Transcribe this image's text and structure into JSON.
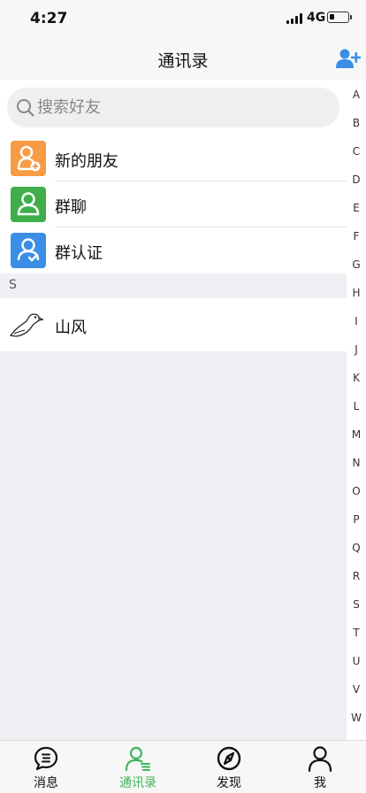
{
  "status_bar": {
    "time": "4:27",
    "network": "4G",
    "battery_percent": 20
  },
  "header": {
    "title": "通讯录",
    "add_icon": "add-friend-icon"
  },
  "search": {
    "placeholder": "搜索好友",
    "value": ""
  },
  "menu": [
    {
      "label": "新的朋友",
      "icon": "new-friend-icon",
      "color": "#f79b44"
    },
    {
      "label": "群聊",
      "icon": "group-chat-icon",
      "color": "#3fae4a"
    },
    {
      "label": "群认证",
      "icon": "group-verify-icon",
      "color": "#3a8ee6"
    }
  ],
  "sections": [
    {
      "letter": "S",
      "contacts": [
        {
          "name": "山风",
          "avatar": "goose-avatar"
        }
      ]
    }
  ],
  "index_letters": [
    "A",
    "B",
    "C",
    "D",
    "E",
    "F",
    "G",
    "H",
    "I",
    "J",
    "K",
    "L",
    "M",
    "N",
    "O",
    "P",
    "Q",
    "R",
    "S",
    "T",
    "U",
    "V",
    "W"
  ],
  "tabs": [
    {
      "label": "消息",
      "icon": "message-icon",
      "active": false
    },
    {
      "label": "通讯录",
      "icon": "contacts-icon",
      "active": true
    },
    {
      "label": "发现",
      "icon": "discover-icon",
      "active": false
    },
    {
      "label": "我",
      "icon": "profile-icon",
      "active": false
    }
  ],
  "colors": {
    "accent": "#41b35d",
    "add_icon": "#3a8ee6"
  }
}
